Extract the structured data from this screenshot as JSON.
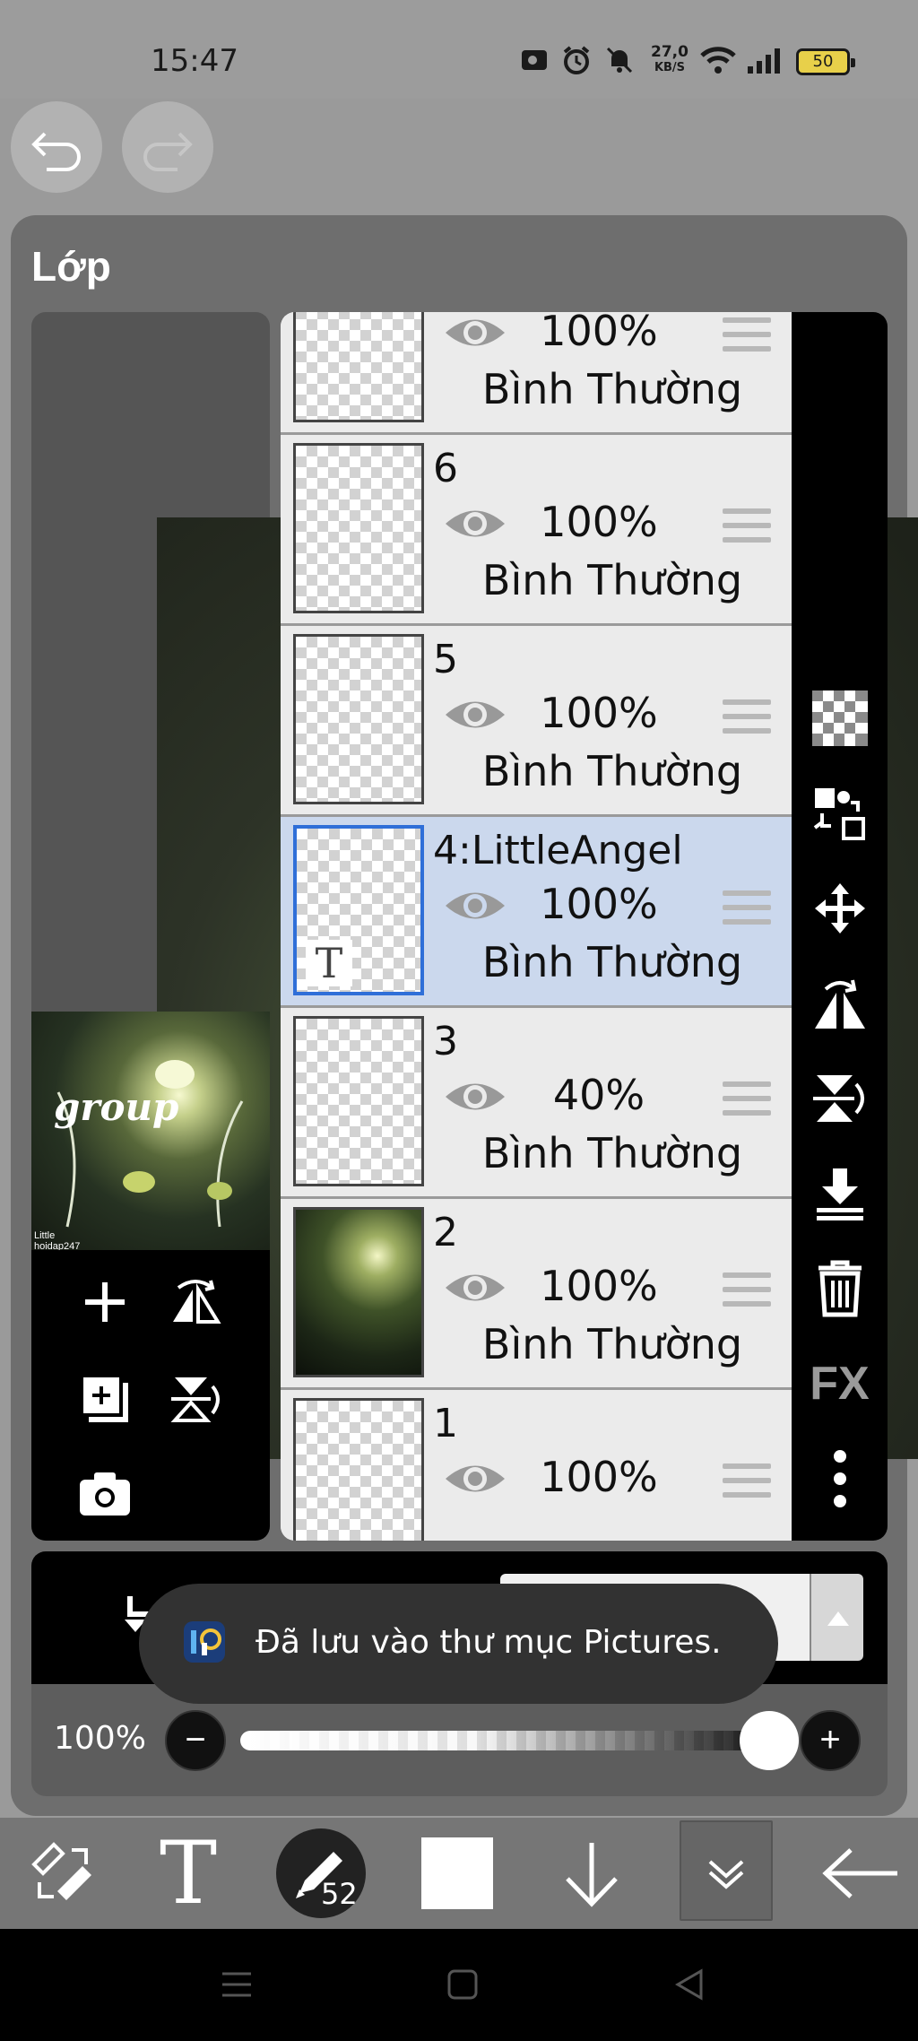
{
  "status_bar": {
    "time": "15:47",
    "net_speed_value": "27,0",
    "net_speed_unit": "KB/S",
    "battery": "50"
  },
  "panel": {
    "title": "Lớp"
  },
  "preview": {
    "text": "group",
    "credit_line1": "Little",
    "credit_line2": "hoidap247"
  },
  "layers": [
    {
      "name": "",
      "opacity": "100%",
      "blend": "Bình Thường"
    },
    {
      "name": "6",
      "opacity": "100%",
      "blend": "Bình Thường"
    },
    {
      "name": "5",
      "opacity": "100%",
      "blend": "Bình Thường"
    },
    {
      "name": "4:LittleAngel",
      "opacity": "100%",
      "blend": "Bình Thường",
      "selected": true,
      "is_text_layer": true
    },
    {
      "name": "3",
      "opacity": "40%",
      "blend": "Bình Thường"
    },
    {
      "name": "2",
      "opacity": "100%",
      "blend": "Bình Thường"
    },
    {
      "name": "1",
      "opacity": "100%",
      "blend": ""
    }
  ],
  "thumb_text_label": "T",
  "right_toolbar": {
    "fx_label": "FX"
  },
  "opacity_control": {
    "value": "100%",
    "minus": "−",
    "plus": "+",
    "level": 1.0
  },
  "toast": {
    "message": "Đã lưu vào thư mục Pictures."
  },
  "bottom_toolbar": {
    "text_tool_label": "T",
    "brush_size": "52",
    "primary_color": "#ffffff"
  },
  "colors": {
    "selected_layer_bg": "#cbd8ed",
    "selected_layer_border": "#2f6fd8",
    "panel_bg": "#6e6e6e"
  }
}
